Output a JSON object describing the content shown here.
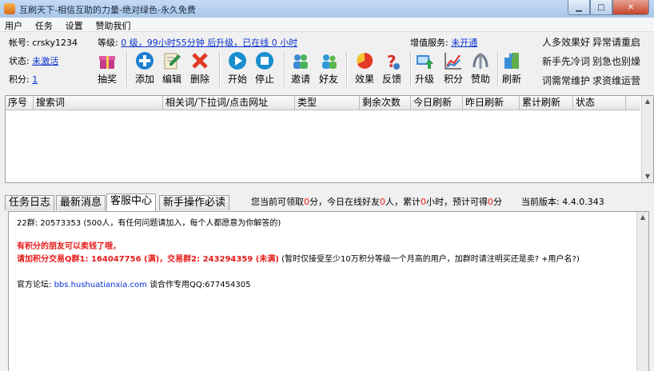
{
  "window": {
    "title": "互刷天下-相信互助的力量-绝对绿色-永久免费"
  },
  "menu": [
    "用户",
    "任务",
    "设置",
    "赞助我们"
  ],
  "account": {
    "account_label": "帐号:",
    "account_value": "crsky1234",
    "level_label": "等级:",
    "level_value": "0 级，99小时55分钟 后升级，已在线 0 小时",
    "status_label": "状态:",
    "status_value": "未激活",
    "points_label": "积分:",
    "points_value": "1",
    "vip_label": "增值服务:",
    "vip_value": "未开通"
  },
  "toolbar": [
    "抽奖",
    "添加",
    "编辑",
    "删除",
    "开始",
    "停止",
    "邀请",
    "好友",
    "效果",
    "反馈",
    "升级",
    "积分",
    "赞助",
    "刷新"
  ],
  "ads": [
    "人多效果好",
    "异常请重启",
    "新手先冷词",
    "别急也别燥",
    "词需常维护",
    "求资维运营"
  ],
  "grid": {
    "columns": [
      "序号",
      "搜索词",
      "相关词/下拉词/点击网址",
      "类型",
      "剩余次数",
      "今日刷新",
      "昨日刷新",
      "累计刷新",
      "状态"
    ]
  },
  "tabs": [
    "任务日志",
    "最新消息",
    "客服中心",
    "新手操作必读"
  ],
  "status": {
    "p1": "您当前可领取",
    "v1": "0",
    "p2": "分，今日在线好友",
    "v2": "0",
    "p3": "人，累计",
    "v3": "0",
    "p4": "小时，预计可得",
    "v4": "0",
    "p5": "分",
    "version_label": "当前版本:",
    "version_value": "4.4.0.343"
  },
  "content": {
    "line1": "22群: 20573353 (500人，有任何问题请加入，每个人都愿意为你解答的)",
    "line2": "有积分的朋友可以卖钱了哦，",
    "line3_red": "请加积分交易Q群1: 164047756 (满)，交易群2: 243294359 (未满)",
    "line3_black": "(暂时仅接受至少10万积分等级一个月高的用户，加群时请注明买还是卖? +用户名?)",
    "forum_label": "官方论坛:",
    "forum_url": "bbs.hushuatianxia.com",
    "forum_tail": "谈合作专用QQ:677454305"
  },
  "colors": {
    "link": "#0a32d2",
    "highlight": "#e51b1b",
    "title_bar": "#b9d1ee"
  }
}
